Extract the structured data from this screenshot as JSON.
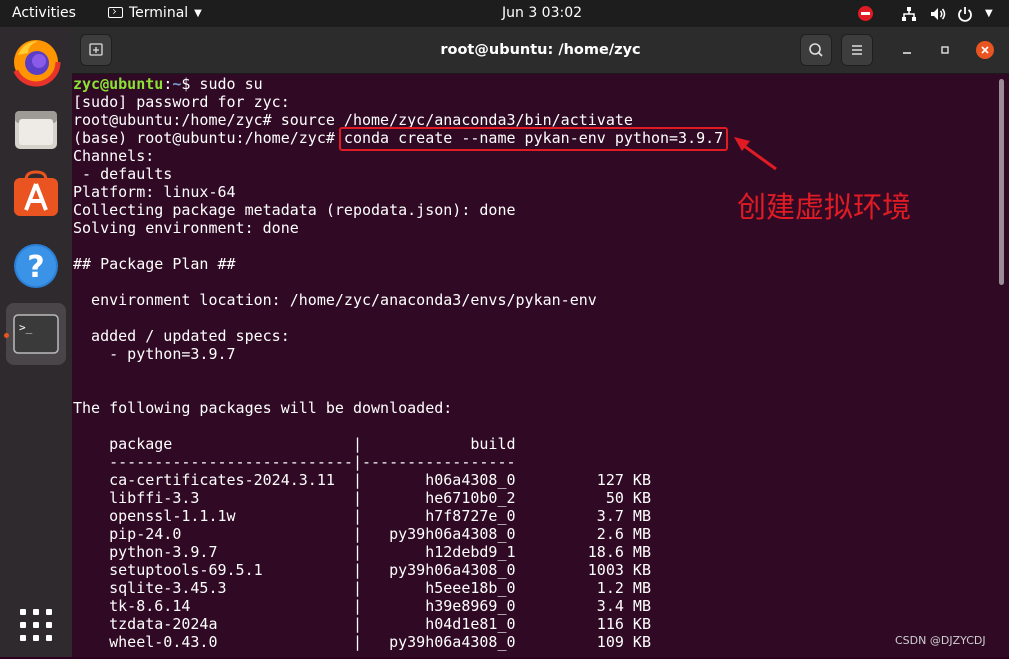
{
  "topbar": {
    "activities": "Activities",
    "app_menu": "Terminal",
    "clock": "Jun 3  03:02"
  },
  "window": {
    "title": "root@ubuntu: /home/zyc"
  },
  "terminal": {
    "lines": [
      {
        "segments": [
          {
            "text": "zyc@ubuntu",
            "style": "user"
          },
          {
            "text": ":",
            "style": "plain"
          },
          {
            "text": "~",
            "style": "path"
          },
          {
            "text": "$ sudo su",
            "style": "plain"
          }
        ]
      },
      {
        "segments": [
          {
            "text": "[sudo] password for zyc:",
            "style": "plain"
          }
        ]
      },
      {
        "segments": [
          {
            "text": "root@ubuntu:/home/zyc# source /home/zyc/anaconda3/bin/activate",
            "style": "plain"
          }
        ]
      },
      {
        "segments": [
          {
            "text": "(base) root@ubuntu:/home/zyc# conda create --name pykan-env python=3.9.7",
            "style": "plain"
          }
        ]
      },
      {
        "segments": [
          {
            "text": "Channels:",
            "style": "plain"
          }
        ]
      },
      {
        "segments": [
          {
            "text": " - defaults",
            "style": "plain"
          }
        ]
      },
      {
        "segments": [
          {
            "text": "Platform: linux-64",
            "style": "plain"
          }
        ]
      },
      {
        "segments": [
          {
            "text": "Collecting package metadata (repodata.json): done",
            "style": "plain"
          }
        ]
      },
      {
        "segments": [
          {
            "text": "Solving environment: done",
            "style": "plain"
          }
        ]
      },
      {
        "segments": [
          {
            "text": "",
            "style": "plain"
          }
        ]
      },
      {
        "segments": [
          {
            "text": "## Package Plan ##",
            "style": "plain"
          }
        ]
      },
      {
        "segments": [
          {
            "text": "",
            "style": "plain"
          }
        ]
      },
      {
        "segments": [
          {
            "text": "  environment location: /home/zyc/anaconda3/envs/pykan-env",
            "style": "plain"
          }
        ]
      },
      {
        "segments": [
          {
            "text": "",
            "style": "plain"
          }
        ]
      },
      {
        "segments": [
          {
            "text": "  added / updated specs:",
            "style": "plain"
          }
        ]
      },
      {
        "segments": [
          {
            "text": "    - python=3.9.7",
            "style": "plain"
          }
        ]
      },
      {
        "segments": [
          {
            "text": "",
            "style": "plain"
          }
        ]
      },
      {
        "segments": [
          {
            "text": "",
            "style": "plain"
          }
        ]
      },
      {
        "segments": [
          {
            "text": "The following packages will be downloaded:",
            "style": "plain"
          }
        ]
      },
      {
        "segments": [
          {
            "text": "",
            "style": "plain"
          }
        ]
      },
      {
        "segments": [
          {
            "text": "    package                    |            build",
            "style": "plain"
          }
        ]
      },
      {
        "segments": [
          {
            "text": "    ---------------------------|-----------------",
            "style": "plain"
          }
        ]
      },
      {
        "segments": [
          {
            "text": "    ca-certificates-2024.3.11  |       h06a4308_0         127 KB",
            "style": "plain"
          }
        ]
      },
      {
        "segments": [
          {
            "text": "    libffi-3.3                 |       he6710b0_2          50 KB",
            "style": "plain"
          }
        ]
      },
      {
        "segments": [
          {
            "text": "    openssl-1.1.1w             |       h7f8727e_0         3.7 MB",
            "style": "plain"
          }
        ]
      },
      {
        "segments": [
          {
            "text": "    pip-24.0                   |   py39h06a4308_0         2.6 MB",
            "style": "plain"
          }
        ]
      },
      {
        "segments": [
          {
            "text": "    python-3.9.7               |       h12debd9_1        18.6 MB",
            "style": "plain"
          }
        ]
      },
      {
        "segments": [
          {
            "text": "    setuptools-69.5.1          |   py39h06a4308_0        1003 KB",
            "style": "plain"
          }
        ]
      },
      {
        "segments": [
          {
            "text": "    sqlite-3.45.3              |       h5eee18b_0         1.2 MB",
            "style": "plain"
          }
        ]
      },
      {
        "segments": [
          {
            "text": "    tk-8.6.14                  |       h39e8969_0         3.4 MB",
            "style": "plain"
          }
        ]
      },
      {
        "segments": [
          {
            "text": "    tzdata-2024a               |       h04d1e81_0         116 KB",
            "style": "plain"
          }
        ]
      },
      {
        "segments": [
          {
            "text": "    wheel-0.43.0               |   py39h06a4308_0         109 KB",
            "style": "plain"
          }
        ]
      }
    ]
  },
  "annotation": {
    "text": "创建虚拟环境",
    "color": "#e01b24"
  },
  "watermark": "CSDN @DJZYCDJ",
  "dock": {
    "apps": [
      "firefox-icon",
      "files-icon",
      "app-center-icon",
      "help-icon",
      "terminal-icon"
    ],
    "show_apps": "show-applications-icon"
  },
  "colors": {
    "terminal_bg": "#300a24",
    "prompt_user": "#8ae234",
    "prompt_path": "#729fcf",
    "accent": "#e95420"
  }
}
